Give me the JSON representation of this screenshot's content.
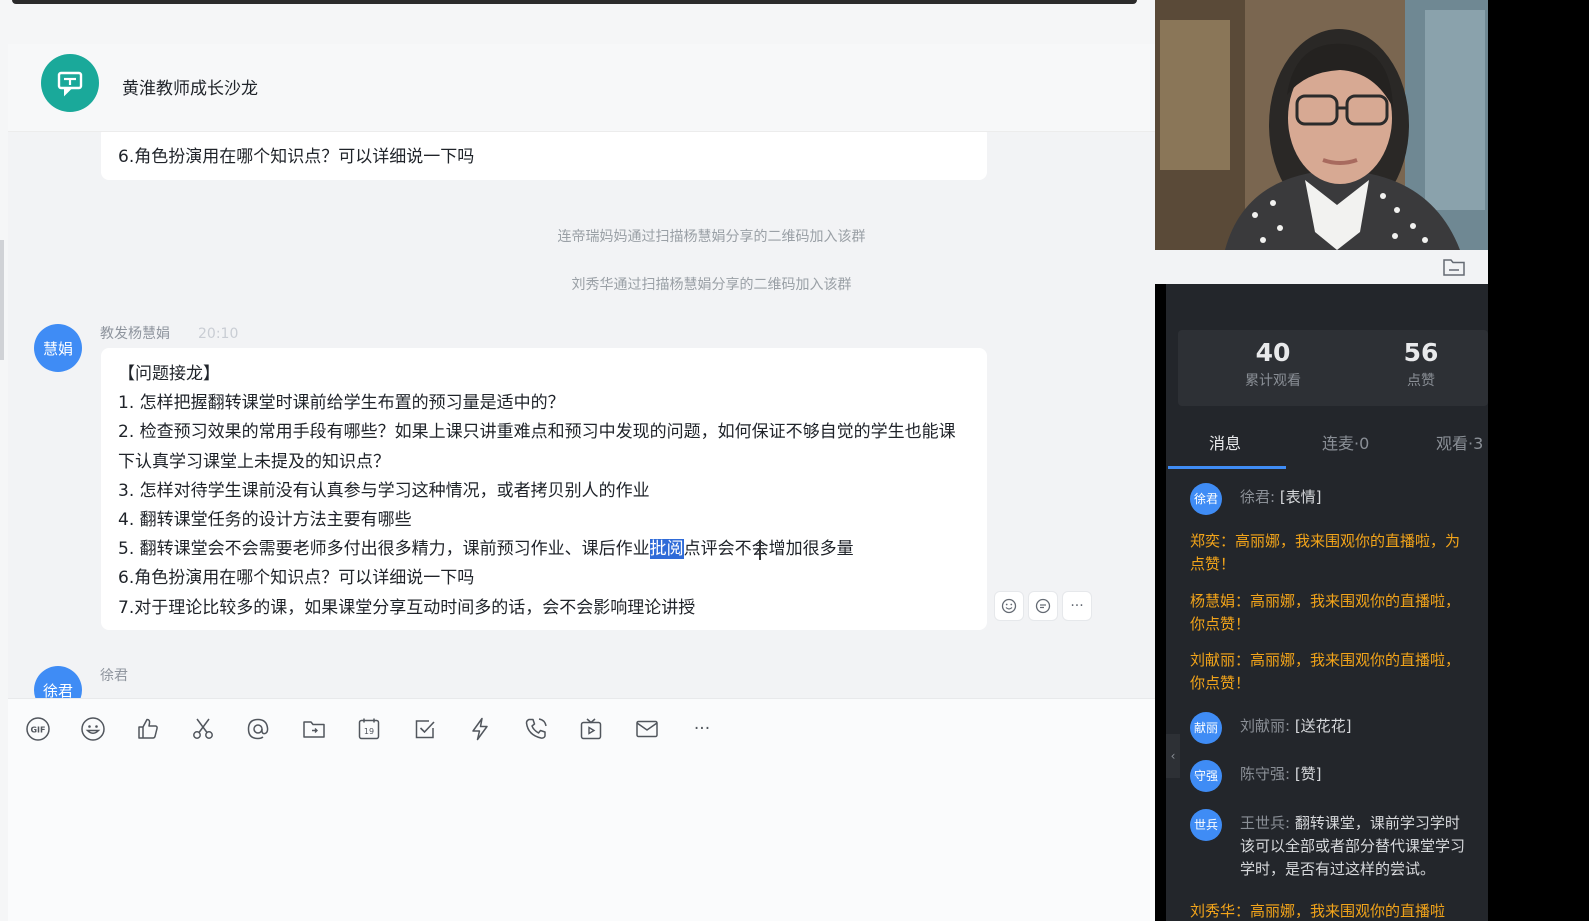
{
  "group": {
    "title": "黄淮教师成长沙龙"
  },
  "messages": {
    "prev_tail": "6.角色扮演用在哪个知识点？可以详细说一下吗",
    "system_1": "连帝瑞妈妈通过扫描杨慧娟分享的二维码加入该群",
    "system_2": "刘秀华通过扫描杨慧娟分享的二维码加入该群",
    "main_sender": {
      "avatar_text": "慧娟",
      "name": "教发杨慧娟",
      "time": "20:10"
    },
    "main_lines": [
      "【问题接龙】",
      "1. 怎样把握翻转课堂时课前给学生布置的预习量是适中的？",
      "2. 检查预习效果的常用手段有哪些？如果上课只讲重难点和预习中发现的问题，如何保证不够自觉的学生也能课下认真学习课堂上未提及的知识点？",
      "3. 怎样对待学生课前没有认真参与学习这种情况，或者拷贝别人的作业",
      "4. 翻转课堂任务的设计方法主要有哪些",
      "6.角色扮演用在哪个知识点？可以详细说一下吗",
      "7.对于理论比较多的课，如果课堂分享互动时间多的话，会不会影响理论讲授"
    ],
    "line5_before": "5. 翻转课堂会不会需要老师多付出很多精力，课前预习作业、课后作业",
    "line5_highlight": "批阅",
    "line5_after": "点评会不会增加很多量",
    "next_sender": {
      "avatar_text": "徐君",
      "name": "徐君"
    }
  },
  "toolbar": {
    "gif_label": "GIF",
    "calendar_label": "19",
    "more_label": "···"
  },
  "live": {
    "views_count": "40",
    "views_label": "累计观看",
    "likes_count": "56",
    "likes_label": "点赞",
    "tabs": [
      "消息",
      "连麦·0",
      "观看·3"
    ],
    "feed": [
      {
        "type": "chat",
        "avatar": "徐君",
        "name": "徐君:",
        "text": " [表情]"
      },
      {
        "type": "gift",
        "line1": "郑奕：高丽娜，我来围观你的直播啦，为",
        "line2": "点赞！"
      },
      {
        "type": "gift",
        "line1": "杨慧娟：高丽娜，我来围观你的直播啦，",
        "line2": "你点赞！"
      },
      {
        "type": "gift",
        "line1": "刘献丽：高丽娜，我来围观你的直播啦，",
        "line2": "你点赞！"
      },
      {
        "type": "chat",
        "avatar": "献丽",
        "name": "刘献丽:",
        "text": " [送花花]"
      },
      {
        "type": "chat",
        "avatar": "守强",
        "name": "陈守强:",
        "text": " [赞]"
      },
      {
        "type": "chat3",
        "avatar": "世兵",
        "name": "王世兵:",
        "text": " 翻转课堂，课前学习学时",
        "line2": "该可以全部或者部分替代课堂学习",
        "line3": "学时，是否有过这样的尝试。"
      },
      {
        "type": "gift",
        "line1": "刘秀华：高丽娜，我来围观你的直播啦"
      }
    ]
  },
  "colors": {
    "accent": "#3f8cf5",
    "group_avatar": "#1aa99a",
    "gift_text": "#f2a41a",
    "panel_bg": "#23262b"
  }
}
